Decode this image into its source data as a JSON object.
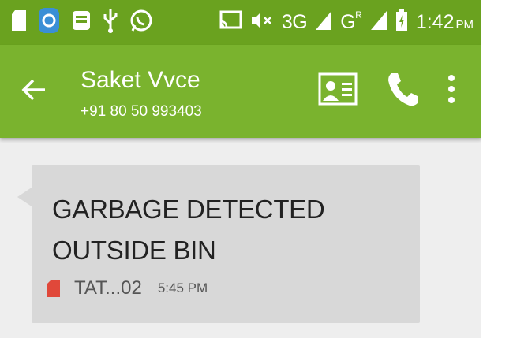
{
  "status_bar": {
    "network_3g": "3G",
    "network_g": "G",
    "network_r": "R",
    "time": "1:42",
    "ampm": "PM",
    "icons": [
      "sd-card-icon",
      "app-icon",
      "usb-storage-icon",
      "usb-icon",
      "whatsapp-icon",
      "cast-icon",
      "mute-icon",
      "signal-icon",
      "battery-icon"
    ]
  },
  "toolbar": {
    "contact_name": "Saket Vvce",
    "contact_number": "+91 80 50 993403"
  },
  "message": {
    "text": "GARBAGE DETECTED OUTSIDE BIN",
    "sender": "TAT...02",
    "time": "5:45 PM"
  },
  "colors": {
    "status_bar": "#6aa21f",
    "toolbar": "#7ab32e",
    "bubble": "#d8d8d8",
    "sim_icon": "#e0483a"
  }
}
